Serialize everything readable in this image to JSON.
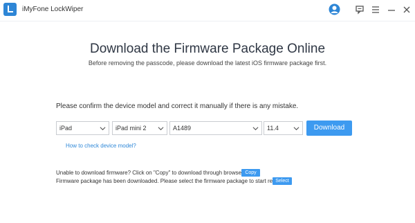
{
  "app": {
    "title": "iMyFone LockWiper"
  },
  "header": {
    "title": "Download the Firmware Package Online",
    "subtitle": "Before removing the passcode, please download the latest iOS firmware package first."
  },
  "form": {
    "instruction": "Please confirm the device model and correct it manually if there is any mistake.",
    "device_type": "iPad",
    "device_model": "iPad mini 2",
    "model_code": "A1489",
    "ios_version": "11.4",
    "download_label": "Download",
    "check_link": "How to check device model?"
  },
  "notes": {
    "download_fail": "Unable to download firmware? Click on \"Copy\" to download through browser.",
    "copy_label": "Copy",
    "already_downloaded": "Firmware package has been downloaded. Please select the firmware package to start repair.",
    "select_label": "Select"
  },
  "icons": {
    "logo": "lockwiper-logo-icon",
    "avatar": "user-avatar-icon",
    "feedback": "feedback-icon",
    "menu": "menu-icon",
    "minimize": "minimize-icon",
    "close": "close-icon",
    "dropdown": "chevron-down-icon"
  },
  "colors": {
    "accent": "#3d9af0",
    "link": "#2f88d8",
    "title": "#2f3744"
  }
}
